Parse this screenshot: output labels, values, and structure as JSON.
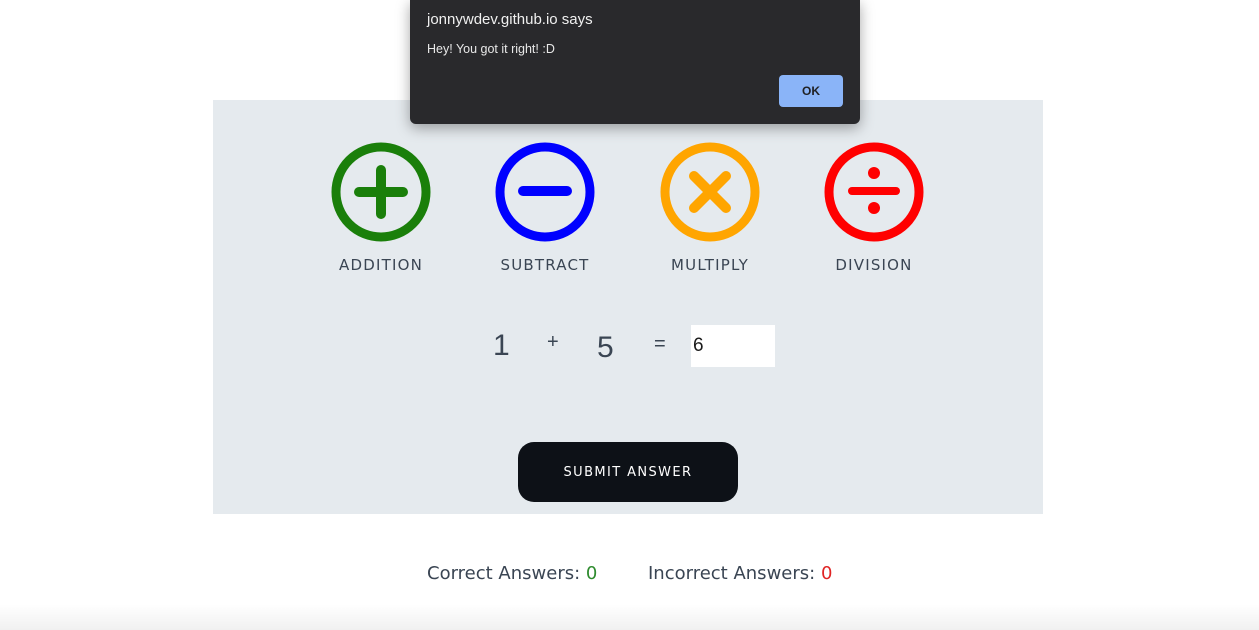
{
  "dialog": {
    "title": "jonnywdev.github.io says",
    "message": "Hey! You got it right! :D",
    "ok_label": "OK",
    "button_color": "#8ab4f8"
  },
  "operations": [
    {
      "label": "ADDITION",
      "icon": "plus-circle-icon",
      "color": "#1a7f0a"
    },
    {
      "label": "SUBTRACT",
      "icon": "minus-circle-icon",
      "color": "#0000ff"
    },
    {
      "label": "MULTIPLY",
      "icon": "times-circle-icon",
      "color": "#ffa500"
    },
    {
      "label": "DIVISION",
      "icon": "divide-circle-icon",
      "color": "#ff0000"
    }
  ],
  "equation": {
    "left_operand": "1",
    "operator": "+",
    "right_operand": "5",
    "equals": "=",
    "answer_value": "6"
  },
  "submit_label": "SUBMIT ANSWER",
  "scores": {
    "correct_label": "Correct Answers:",
    "correct_value": "0",
    "incorrect_label": "Incorrect Answers:",
    "incorrect_value": "0",
    "correct_color": "#2e8b2e",
    "incorrect_color": "#e02424"
  }
}
